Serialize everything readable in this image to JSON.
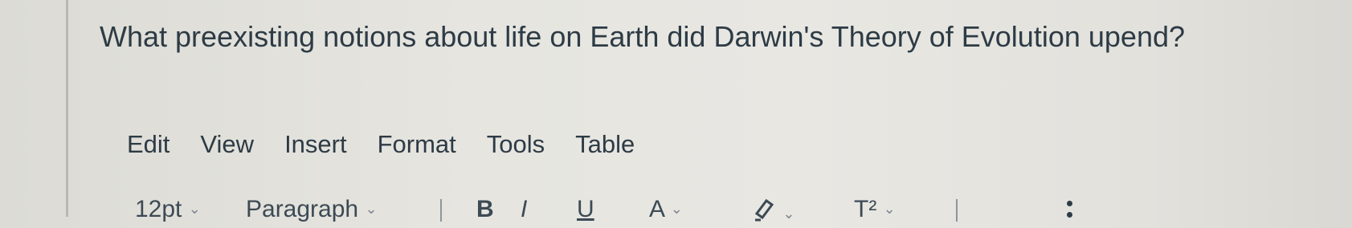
{
  "question": {
    "text": "What preexisting notions about life on Earth did Darwin's Theory of Evolution upend?"
  },
  "menu": {
    "items": [
      {
        "label": "Edit"
      },
      {
        "label": "View"
      },
      {
        "label": "Insert"
      },
      {
        "label": "Format"
      },
      {
        "label": "Tools"
      },
      {
        "label": "Table"
      }
    ]
  },
  "toolbar": {
    "font_size": "12pt",
    "paragraph": "Paragraph",
    "bold": "B",
    "italic": "I",
    "underline": "U",
    "text_color": "A",
    "superscript": "T²",
    "chevron": "⌄",
    "highlight_icon": "highlighter-icon",
    "more_icon": "kebab-icon"
  }
}
